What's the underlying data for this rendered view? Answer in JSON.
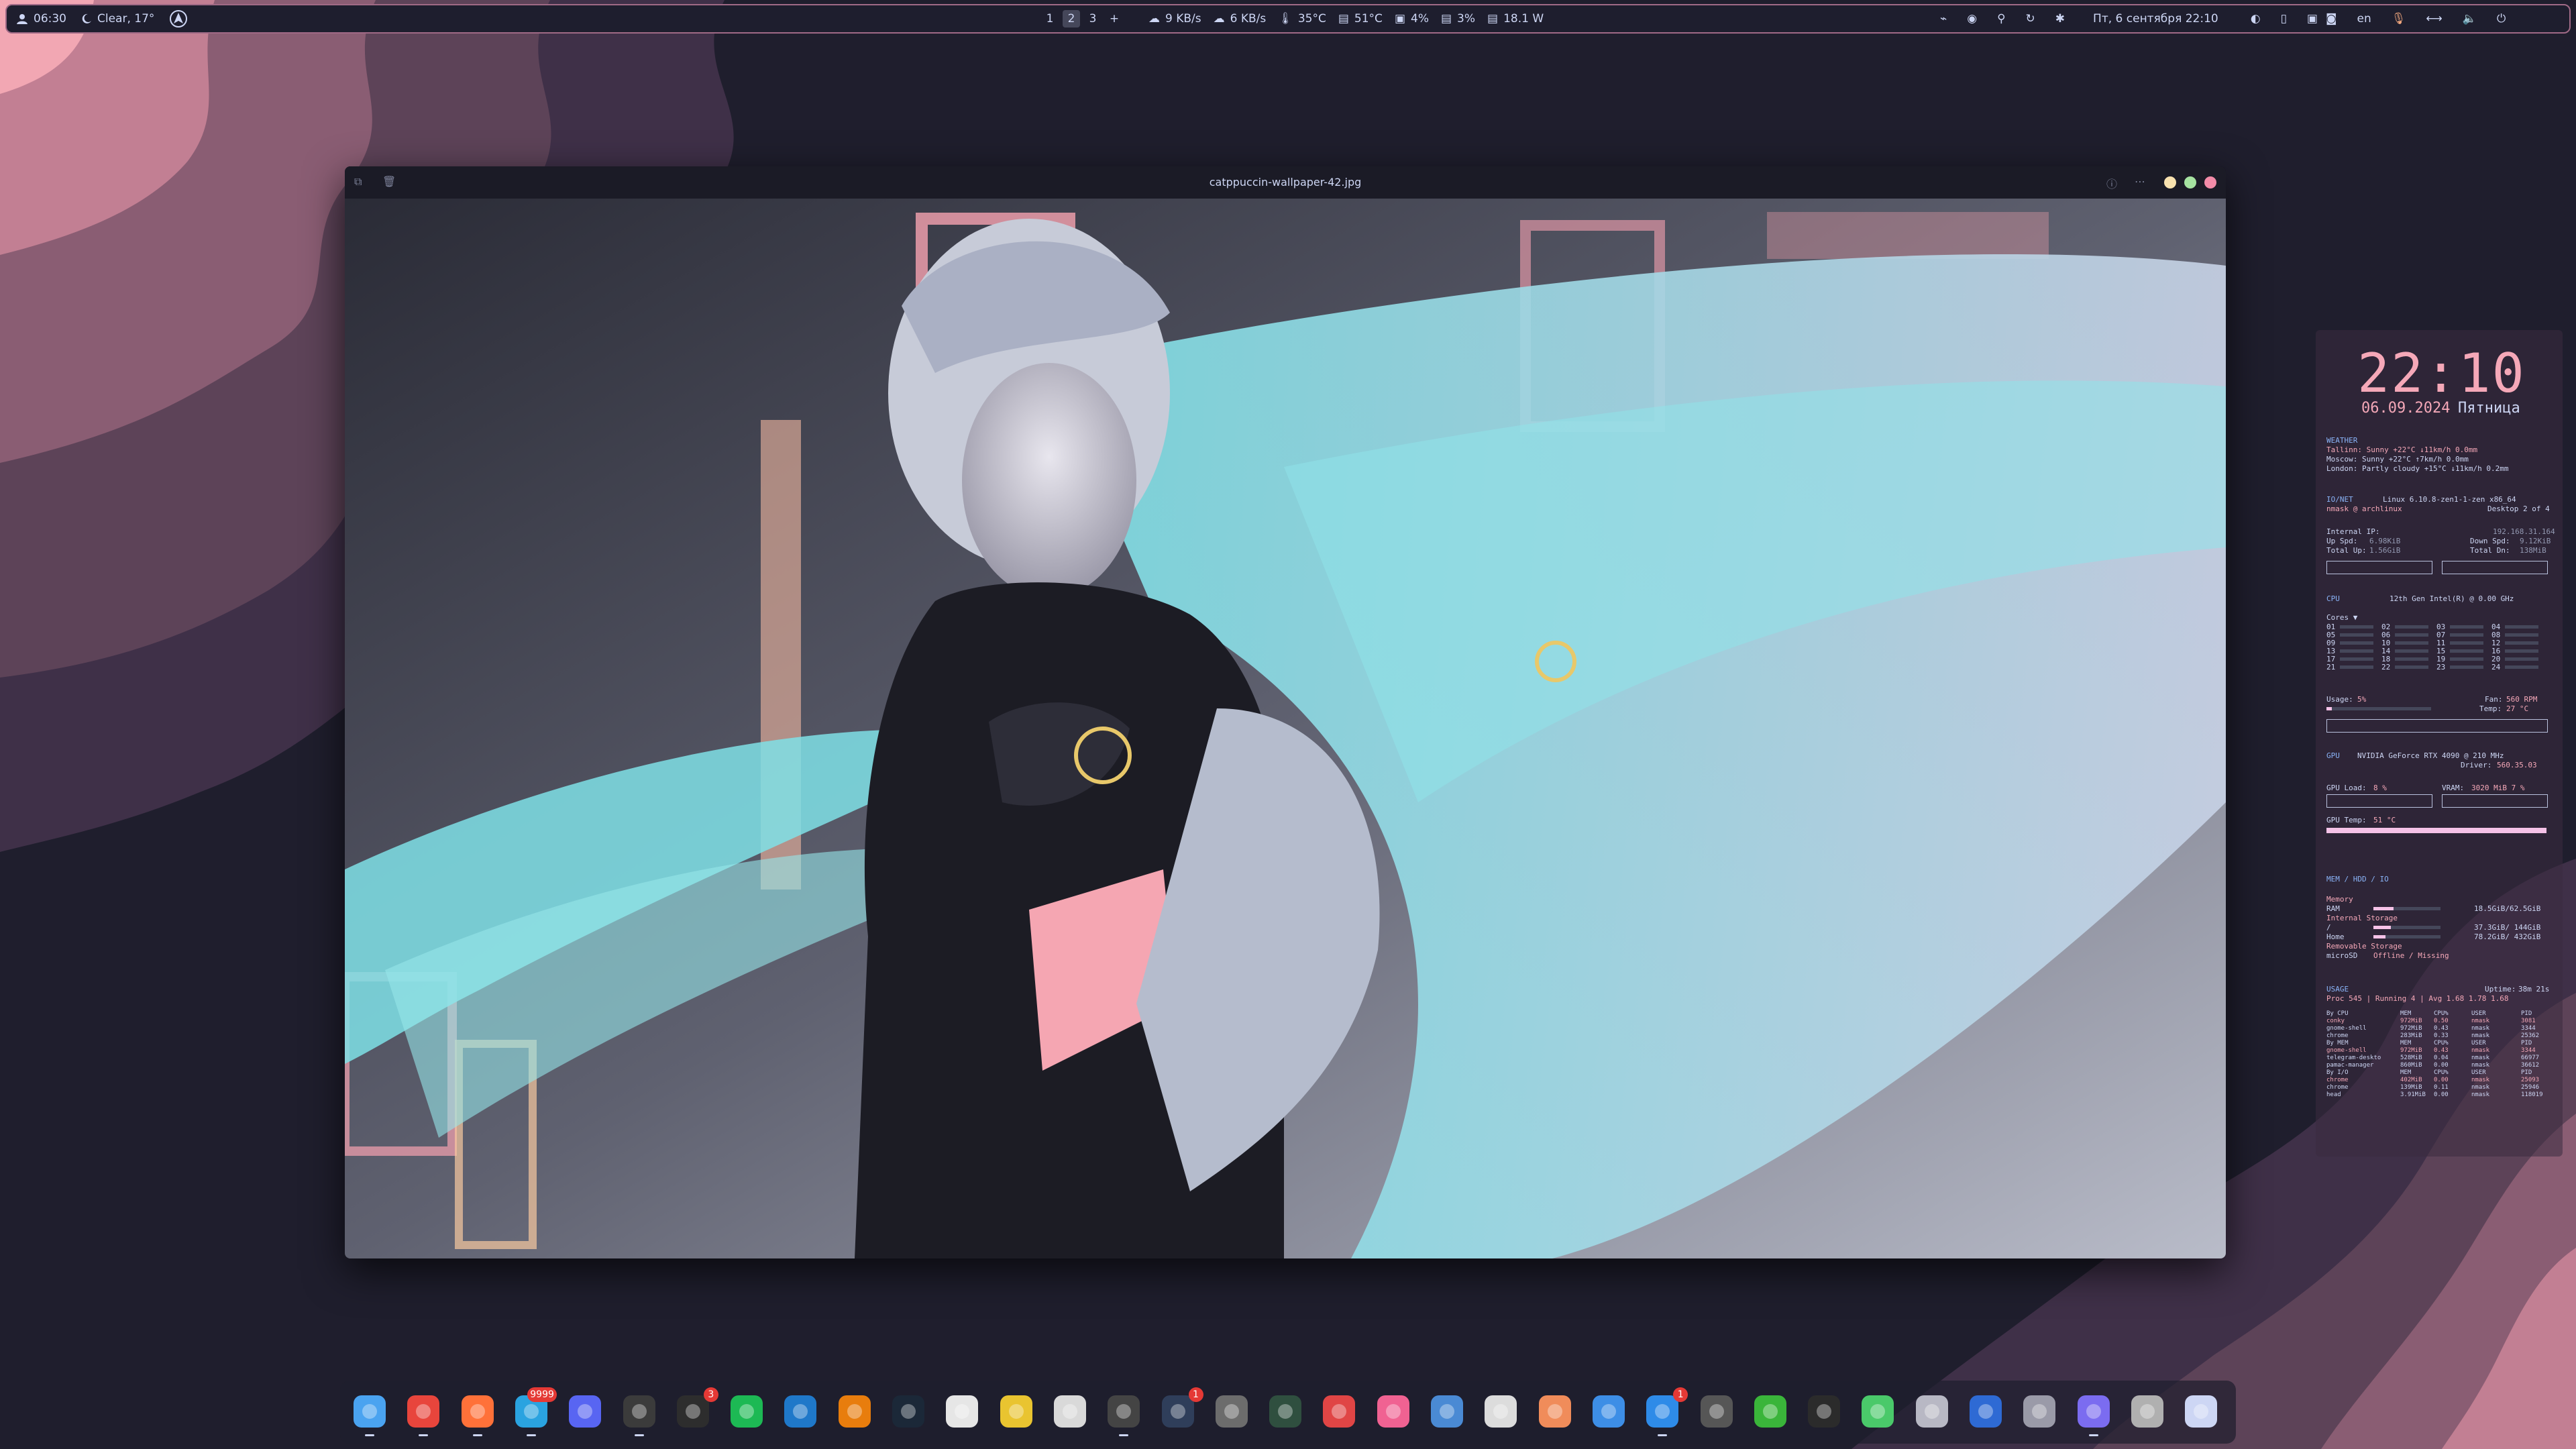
{
  "topbar": {
    "clock_small": "06:30",
    "weather": "Clear, 17°",
    "workspaces": [
      "1",
      "2",
      "3",
      "+"
    ],
    "active_workspace": "2",
    "net_down": "9 KB/s",
    "net_up": "6 KB/s",
    "temp_cpu": "35°C",
    "temp_gpu": "51°C",
    "cpu_load": "4%",
    "gpu_load": "3%",
    "power": "18.1 W",
    "datetime": "Пт, 6 сентября  22:10",
    "lang": "en"
  },
  "viewer": {
    "title": "catppuccin-wallpaper-42.jpg"
  },
  "conky": {
    "clock": "22:10",
    "date": "06.09.2024",
    "day": "Пятница",
    "weather_header": "WEATHER",
    "weather_lines": [
      "Tallinn: Sunny +22°C ↓11km/h 0.0mm",
      "Moscow: Sunny +22°C ↑7km/h 0.0mm",
      "London: Partly cloudy +15°C ↓11km/h 0.2mm"
    ],
    "ionet_header": "IO/NET",
    "kernel": "Linux 6.10.8-zen1-1-zen x86_64",
    "user_host": "nmask @ archlinux",
    "desktop": "Desktop 2 of 4",
    "internal_ip_label": "Internal IP:",
    "internal_ip": "192.168.31.164",
    "up_spd_label": "Up Spd:",
    "up_spd": "6.98KiB",
    "down_spd_label": "Down Spd:",
    "down_spd": "9.12KiB",
    "total_up_label": "Total Up:",
    "total_up": "1.56GiB",
    "total_dn_label": "Total Dn:",
    "total_dn": "138MiB",
    "cpu_header": "CPU",
    "cpu_model": "12th Gen Intel(R) @ 0.00 GHz",
    "cores_label": "Cores ▼",
    "core_rows": [
      [
        "01",
        "02",
        "03",
        "04"
      ],
      [
        "05",
        "06",
        "07",
        "08"
      ],
      [
        "09",
        "10",
        "11",
        "12"
      ],
      [
        "13",
        "14",
        "15",
        "16"
      ],
      [
        "17",
        "18",
        "19",
        "20"
      ],
      [
        "21",
        "22",
        "23",
        "24"
      ]
    ],
    "usage_label": "Usage:",
    "usage": "5%",
    "fan_label": "Fan:",
    "fan": "560 RPM",
    "temp_label": "Temp:",
    "temp": "27 °C",
    "gpu_header": "GPU",
    "gpu_model": "NVIDIA GeForce RTX 4090 @ 210 MHz",
    "driver_label": "Driver:",
    "driver": "560.35.03",
    "gpu_load_label": "GPU Load:",
    "gpu_load": "8 %",
    "vram_label": "VRAM:",
    "vram": "3020 MiB 7 %",
    "gpu_temp_label": "GPU Temp:",
    "gpu_temp": "51 °C",
    "mem_header": "MEM / HDD / IO",
    "memory_label": "Memory",
    "ram_label": "RAM",
    "ram": "18.5GiB/62.5GiB",
    "internal_storage_label": "Internal Storage",
    "root_label": "/",
    "root": "37.3GiB/ 144GiB",
    "home_label": "Home",
    "home": "78.2GiB/ 432GiB",
    "removable_label": "Removable Storage",
    "microsd_label": "microSD",
    "microsd": "Offline / Missing",
    "usage_header": "USAGE",
    "uptime_label": "Uptime:",
    "uptime": "38m 21s",
    "procs_line": "Proc 545  | Running  4 | Avg  1.68 1.78 1.68",
    "by_cpu_header": [
      "By CPU",
      "MEM",
      "CPU%",
      "USER",
      "PID"
    ],
    "by_cpu_rows": [
      [
        "conky",
        "972MiB",
        "0.50",
        "nmask",
        "3081"
      ],
      [
        "gnome-shell",
        "972MiB",
        "0.43",
        "nmask",
        "3344"
      ],
      [
        "chrome",
        "283MiB",
        "0.33",
        "nmask",
        "25362"
      ]
    ],
    "by_mem_header": [
      "By MEM",
      "MEM",
      "CPU%",
      "USER",
      "PID"
    ],
    "by_mem_rows": [
      [
        "gnome-shell",
        "972MiB",
        "0.43",
        "nmask",
        "3344"
      ],
      [
        "telegram-deskto",
        "528MiB",
        "0.04",
        "nmask",
        "66977"
      ],
      [
        "pamac-manager",
        "860MiB",
        "0.00",
        "nmask",
        "36612"
      ]
    ],
    "by_io_header": [
      "By I/O",
      "MEM",
      "CPU%",
      "USER",
      "PID"
    ],
    "by_io_rows": [
      [
        "chrome",
        "402MiB",
        "0.00",
        "nmask",
        "25093"
      ],
      [
        "chrome",
        "139MiB",
        "0.11",
        "nmask",
        "25946"
      ],
      [
        "head",
        "3.91MiB",
        "0.00",
        "nmask",
        "118019"
      ]
    ]
  },
  "dock": {
    "apps": [
      {
        "icon": "files-icon",
        "color": "#4aa3f0",
        "running": true
      },
      {
        "icon": "chrome-icon",
        "color": "#e8453c",
        "running": true
      },
      {
        "icon": "firefox-icon",
        "color": "#ff7139",
        "running": true
      },
      {
        "icon": "telegram-icon",
        "color": "#2aa3e0",
        "running": true,
        "badge": "9999"
      },
      {
        "icon": "discord-icon",
        "color": "#5865f2",
        "running": false
      },
      {
        "icon": "terminal-ide-icon",
        "color": "#3b3b3b",
        "running": true
      },
      {
        "icon": "terminal-icon",
        "color": "#2d2d2d",
        "running": false,
        "badge": "3"
      },
      {
        "icon": "spotify-icon",
        "color": "#1db954",
        "running": false
      },
      {
        "icon": "vscode-icon",
        "color": "#1f78c9",
        "running": false
      },
      {
        "icon": "blender-icon",
        "color": "#e87d0d",
        "running": false
      },
      {
        "icon": "steam-icon",
        "color": "#1b2838",
        "running": false
      },
      {
        "icon": "gamepad-icon",
        "color": "#e6e6e6",
        "running": false
      },
      {
        "icon": "bottles-icon",
        "color": "#e9c430",
        "running": false
      },
      {
        "icon": "gimp-icon",
        "color": "#d9d9d9",
        "running": false
      },
      {
        "icon": "inkscape-icon",
        "color": "#444444",
        "running": true
      },
      {
        "icon": "obs-icon",
        "color": "#2f3e5a",
        "running": false,
        "badge": "1"
      },
      {
        "icon": "timeshift-icon",
        "color": "#6c6c6c",
        "running": false
      },
      {
        "icon": "system-monitor-icon",
        "color": "#2f4f3f",
        "running": false
      },
      {
        "icon": "remote-desktop-icon",
        "color": "#e04545",
        "running": false
      },
      {
        "icon": "notes-icon",
        "color": "#f06292",
        "running": false
      },
      {
        "icon": "qbittorrent-icon",
        "color": "#4a8ad4",
        "running": false
      },
      {
        "icon": "disks-icon",
        "color": "#dcdcdc",
        "running": false
      },
      {
        "icon": "color-picker-icon",
        "color": "#f08c5a",
        "running": false
      },
      {
        "icon": "software-store-icon",
        "color": "#3d8ee6",
        "running": false
      },
      {
        "icon": "mail-icon",
        "color": "#2e8be8",
        "running": true,
        "badge": "1"
      },
      {
        "icon": "binoculars-icon",
        "color": "#565656",
        "running": false
      },
      {
        "icon": "activity-icon",
        "color": "#3ab53a",
        "running": false
      },
      {
        "icon": "nvidia-icon",
        "color": "#2b2b2b",
        "running": false
      },
      {
        "icon": "extensions-icon",
        "color": "#4ac96a",
        "running": false
      },
      {
        "icon": "settings-icon",
        "color": "#b8b8c4",
        "running": false
      },
      {
        "icon": "tweaks-icon",
        "color": "#2e6ad4",
        "running": false
      },
      {
        "icon": "steering-icon",
        "color": "#9a9aa8",
        "running": false
      },
      {
        "icon": "image-viewer-icon",
        "color": "#7b6cf0",
        "running": true
      },
      {
        "icon": "trash-icon",
        "color": "#b0b0b0",
        "running": false
      },
      {
        "icon": "app-grid-icon",
        "color": "#cdd6f4",
        "running": false
      }
    ]
  }
}
